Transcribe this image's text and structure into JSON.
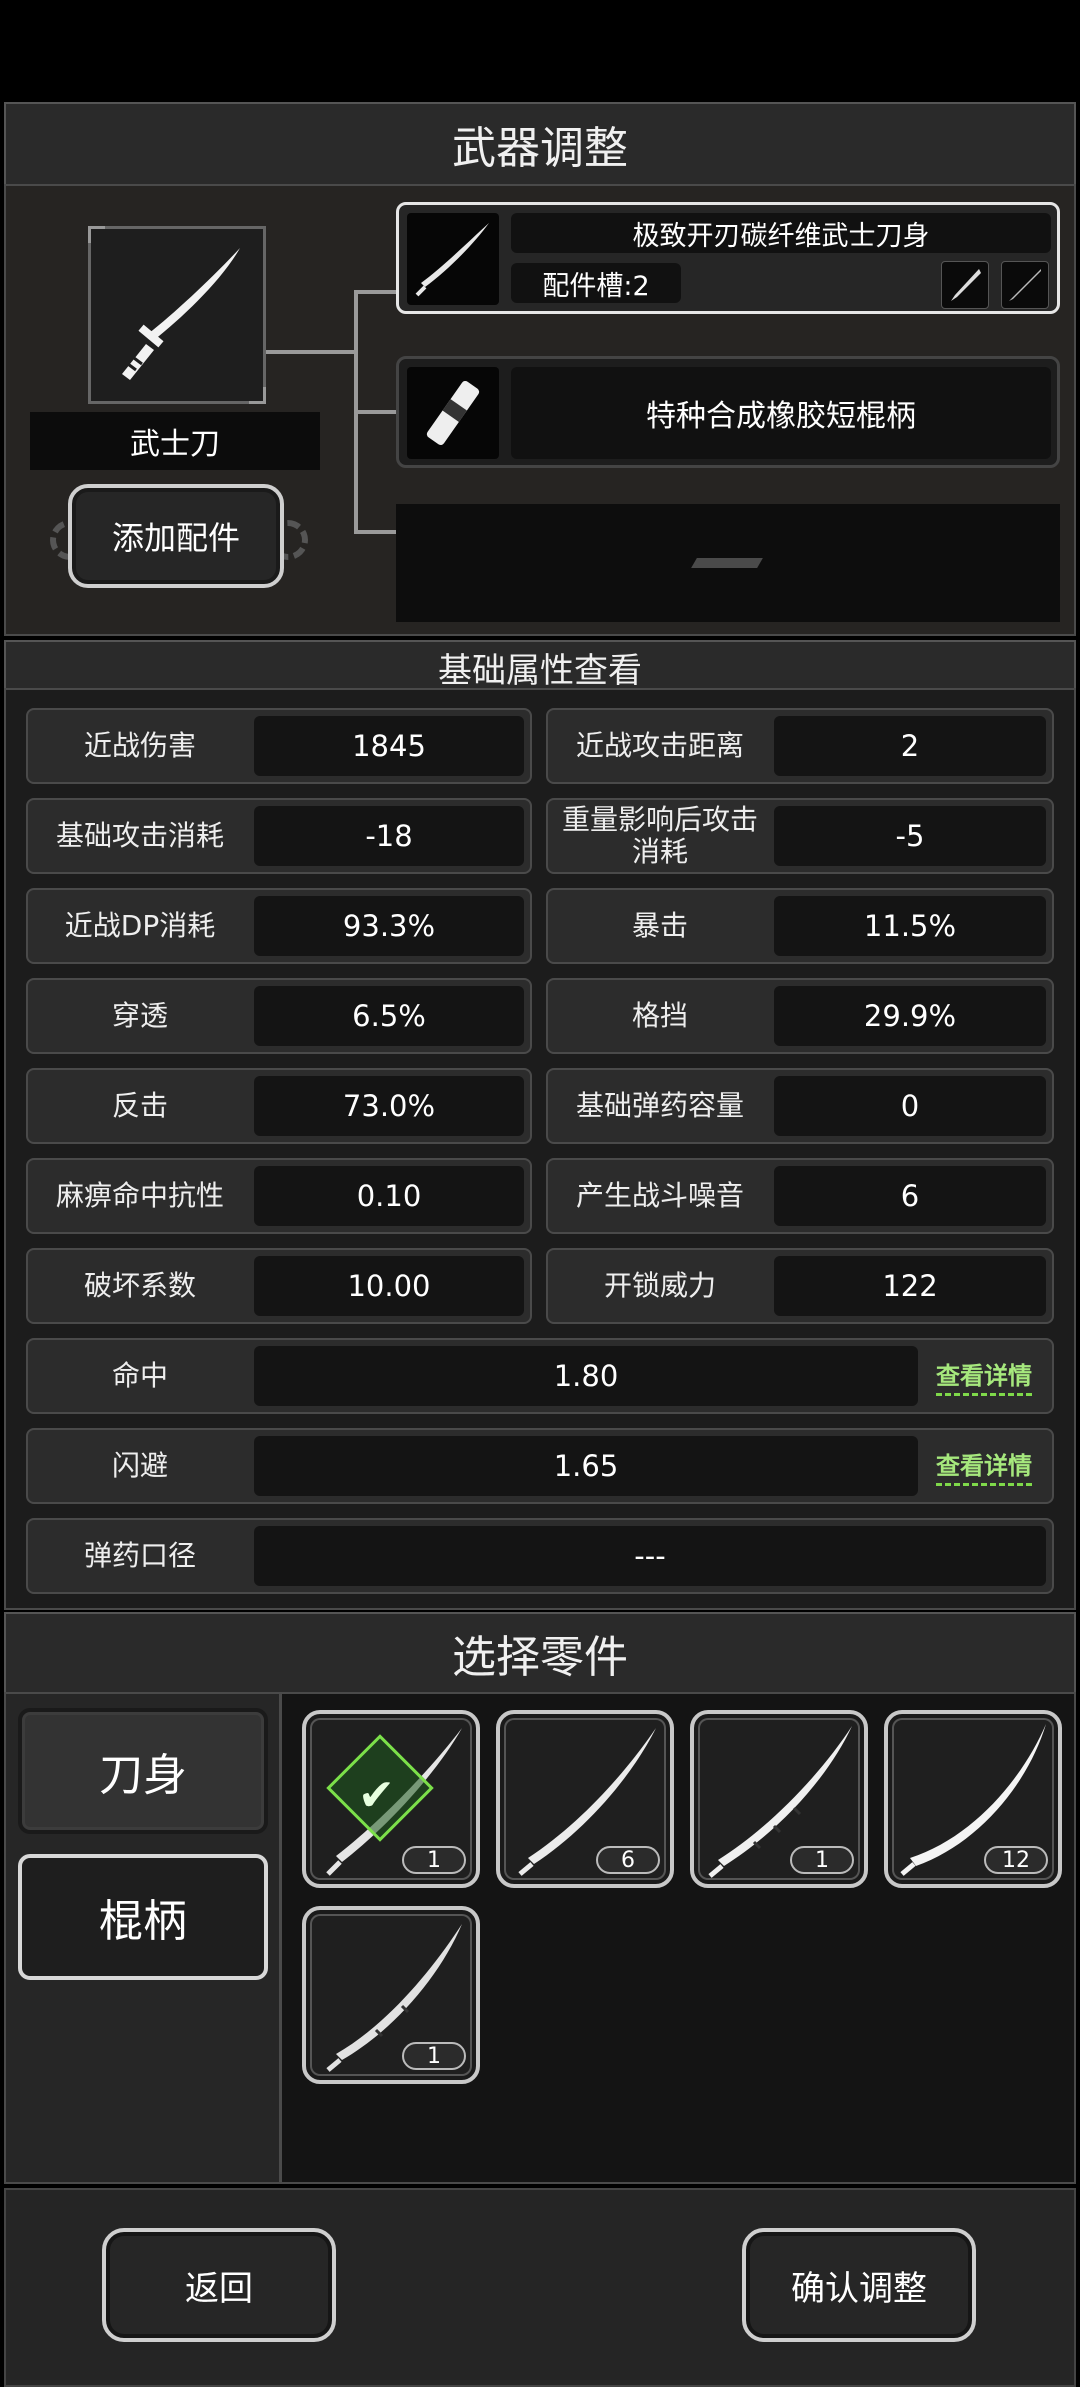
{
  "header": {
    "title": "武器调整"
  },
  "weapon": {
    "name": "武士刀",
    "add_attachment_label": "添加配件",
    "parts": [
      {
        "name": "极致开刃碳纤维武士刀身",
        "slot_label": "配件槽:2",
        "selected": true
      },
      {
        "name": "特种合成橡胶短棍柄",
        "selected": false
      }
    ]
  },
  "stats": {
    "title": "基础属性查看",
    "pairs": [
      {
        "left_label": "近战伤害",
        "left_value": "1845",
        "right_label": "近战攻击距离",
        "right_value": "2"
      },
      {
        "left_label": "基础攻击消耗",
        "left_value": "-18",
        "right_label": "重量影响后攻击消耗",
        "right_value": "-5"
      },
      {
        "left_label": "近战DP消耗",
        "left_value": "93.3%",
        "right_label": "暴击",
        "right_value": "11.5%"
      },
      {
        "left_label": "穿透",
        "left_value": "6.5%",
        "right_label": "格挡",
        "right_value": "29.9%"
      },
      {
        "left_label": "反击",
        "left_value": "73.0%",
        "right_label": "基础弹药容量",
        "right_value": "0"
      },
      {
        "left_label": "麻痹命中抗性",
        "left_value": "0.10",
        "right_label": "产生战斗噪音",
        "right_value": "6"
      },
      {
        "left_label": "破坏系数",
        "left_value": "10.00",
        "right_label": "开锁威力",
        "right_value": "122"
      }
    ],
    "wide": [
      {
        "label": "命中",
        "value": "1.80",
        "link": "查看详情"
      },
      {
        "label": "闪避",
        "value": "1.65",
        "link": "查看详情"
      },
      {
        "label": "弹药口径",
        "value": "---"
      }
    ]
  },
  "selection": {
    "title": "选择零件",
    "tabs": [
      {
        "label": "刀身",
        "active": true
      },
      {
        "label": "棍柄",
        "active": false
      }
    ],
    "items": [
      {
        "qty": "1",
        "equipped": true
      },
      {
        "qty": "6",
        "equipped": false
      },
      {
        "qty": "1",
        "equipped": false
      },
      {
        "qty": "12",
        "equipped": false
      },
      {
        "qty": "1",
        "equipped": false
      }
    ]
  },
  "footer": {
    "back_label": "返回",
    "confirm_label": "确认调整"
  },
  "colors": {
    "link": "#a6e87d",
    "equipped": "#7ce04a",
    "border": "#cfcfcf"
  }
}
